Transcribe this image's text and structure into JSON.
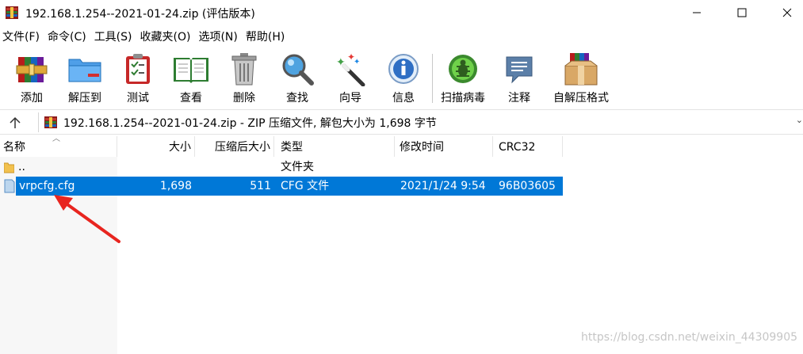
{
  "window": {
    "title": "192.168.1.254--2021-01-24.zip (评估版本)"
  },
  "menu": [
    "文件(F)",
    "命令(C)",
    "工具(S)",
    "收藏夹(O)",
    "选项(N)",
    "帮助(H)"
  ],
  "toolbar": {
    "add": "添加",
    "extract_to": "解压到",
    "test": "测试",
    "view": "查看",
    "delete": "删除",
    "find": "查找",
    "wizard": "向导",
    "info": "信息",
    "virus_scan": "扫描病毒",
    "comment": "注释",
    "sfx": "自解压格式"
  },
  "address": {
    "text": "192.168.1.254--2021-01-24.zip - ZIP 压缩文件, 解包大小为 1,698 字节"
  },
  "columns": {
    "name": "名称",
    "size": "大小",
    "packed": "压缩后大小",
    "type": "类型",
    "modified": "修改时间",
    "crc": "CRC32"
  },
  "rows": [
    {
      "name": "..",
      "size": "",
      "packed": "",
      "type": "文件夹",
      "modified": "",
      "crc": ""
    },
    {
      "name": "vrpcfg.cfg",
      "size": "1,698",
      "packed": "511",
      "type": "CFG 文件",
      "modified": "2021/1/24 9:54",
      "crc": "96B03605"
    }
  ],
  "watermark": "https://blog.csdn.net/weixin_44309905",
  "colors": {
    "selection": "#0078d7",
    "annotation_arrow": "#e8251f"
  },
  "icons": [
    "winrar-app-icon",
    "minimize-icon",
    "maximize-icon",
    "close-icon",
    "up-arrow-icon",
    "folder-icon",
    "file-icon"
  ]
}
